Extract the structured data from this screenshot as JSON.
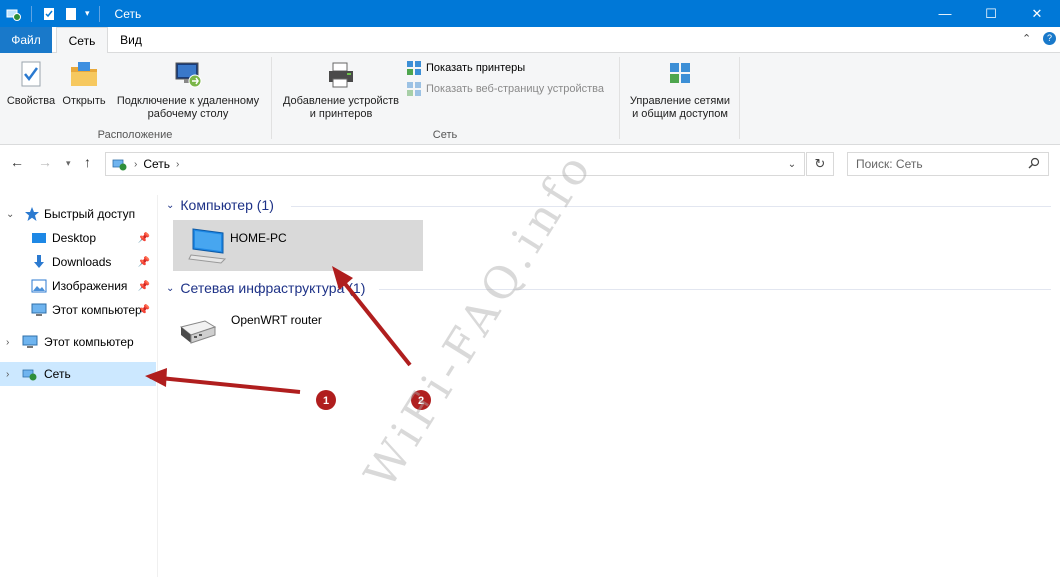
{
  "window": {
    "title": "Сеть",
    "controls": {
      "minimize": "—",
      "maximize": "☐",
      "close": "✕"
    }
  },
  "ribbon": {
    "tabs": [
      {
        "label": "Файл"
      },
      {
        "label": "Сеть"
      },
      {
        "label": "Вид"
      }
    ],
    "groups": {
      "location": {
        "label": "Расположение",
        "buttons": [
          {
            "label": "Свойства"
          },
          {
            "label": "Открыть"
          },
          {
            "label_line1": "Подключение к удаленному",
            "label_line2": "рабочему столу"
          }
        ]
      },
      "network": {
        "label": "Сеть",
        "add_devices_line1": "Добавление устройств",
        "add_devices_line2": "и принтеров",
        "show_printers": "Показать принтеры",
        "show_device_page": "Показать веб-страницу устройства"
      },
      "manage": {
        "label_line1": "Управление сетями",
        "label_line2": "и общим доступом"
      }
    }
  },
  "address": {
    "path": "Сеть",
    "search_placeholder": "Поиск: Сеть"
  },
  "nav": {
    "quick_access": "Быстрый доступ",
    "items": [
      {
        "label": "Desktop"
      },
      {
        "label": "Downloads"
      },
      {
        "label": "Изображения"
      },
      {
        "label": "Этот компьютер"
      }
    ],
    "this_pc": "Этот компьютер",
    "network": "Сеть"
  },
  "content": {
    "groups": [
      {
        "header": "Компьютер (1)",
        "items": [
          {
            "name": "HOME-PC"
          }
        ]
      },
      {
        "header": "Сетевая инфраструктура (1)",
        "items": [
          {
            "name": "OpenWRT router"
          }
        ]
      }
    ]
  },
  "annotations": {
    "marker1": "1",
    "marker2": "2",
    "watermark": "WiFi-FAQ.info",
    "color": "#b01e1e"
  }
}
